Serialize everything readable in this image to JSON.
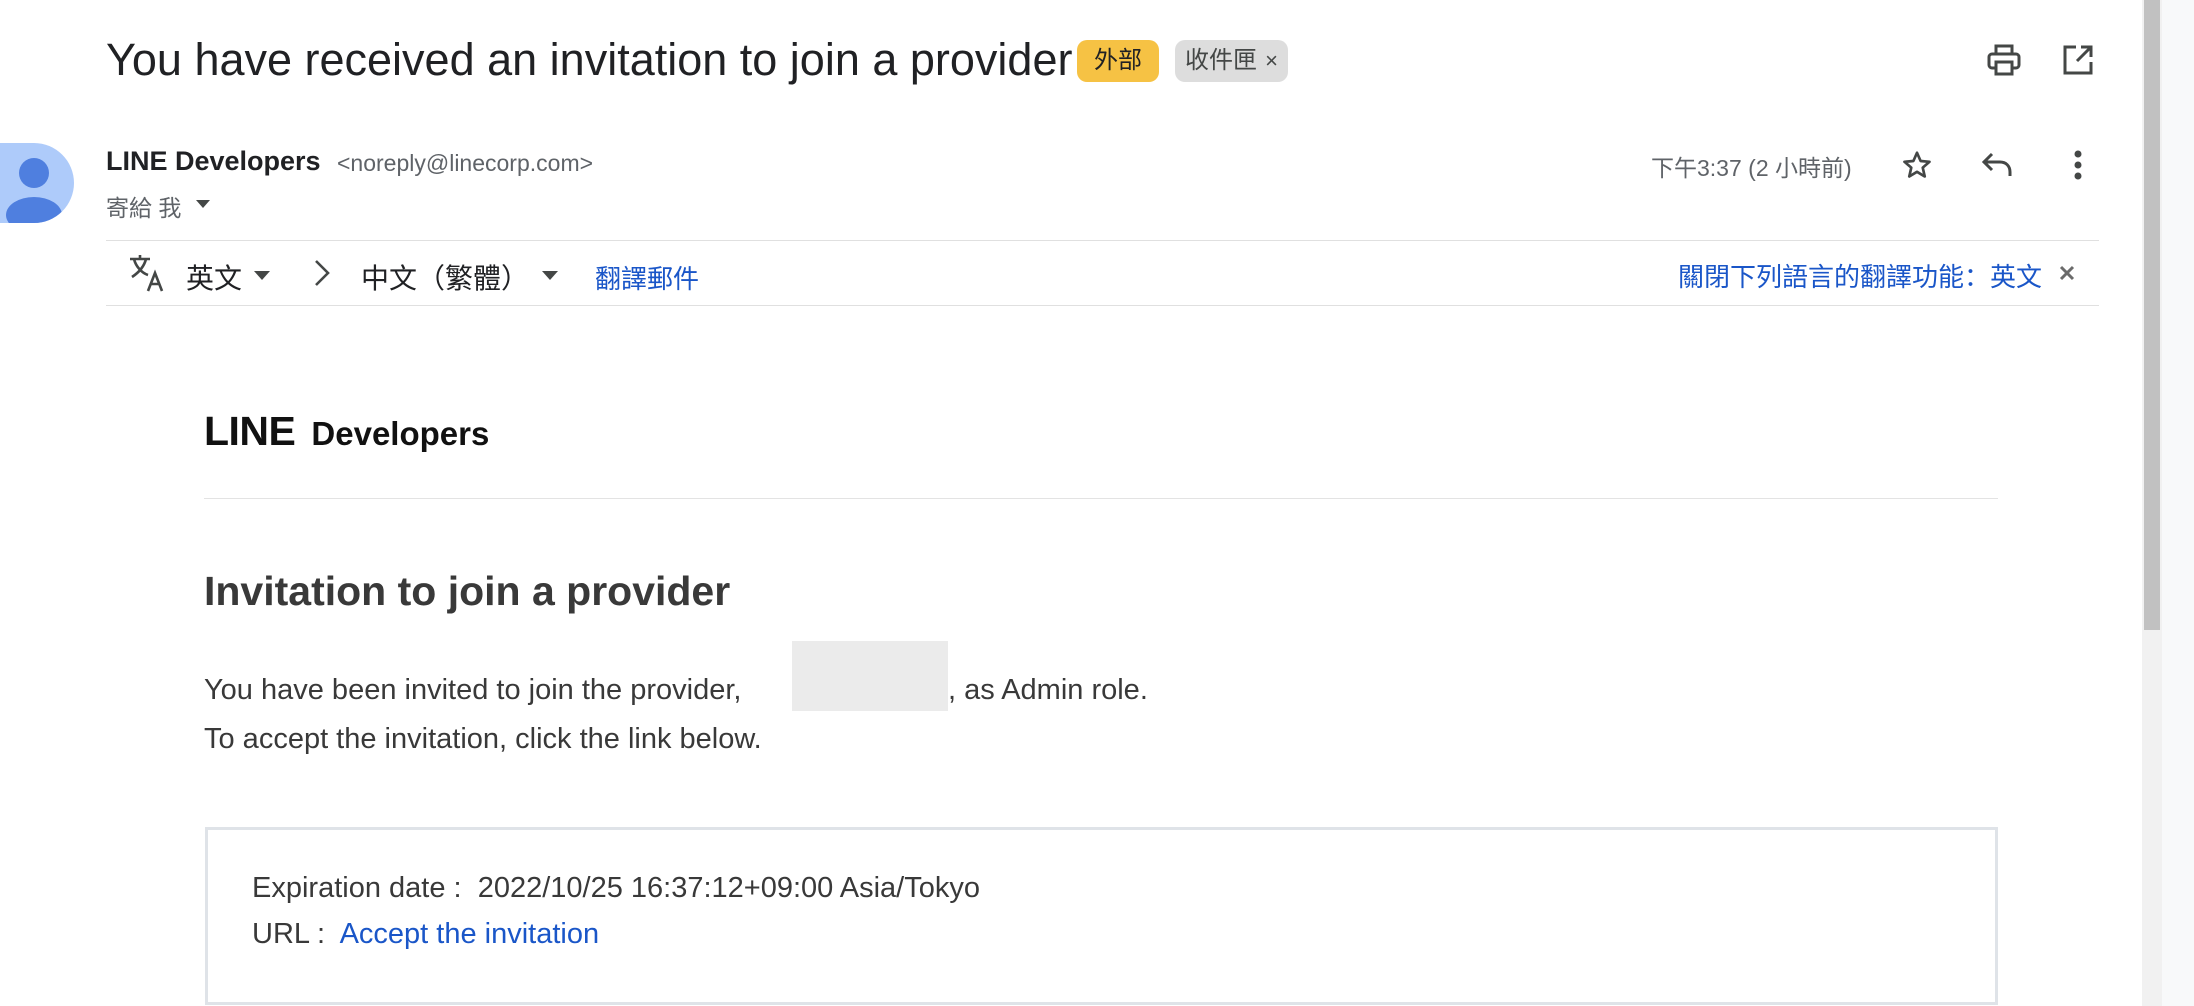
{
  "header": {
    "subject": "You have received an invitation to join a provider",
    "labels": {
      "external": "外部",
      "inbox": "收件匣",
      "inbox_remove": "×"
    },
    "icons": [
      "print-icon",
      "open-in-new-window-icon"
    ]
  },
  "message": {
    "sender_name": "LINE Developers",
    "sender_email": "<noreply@linecorp.com>",
    "recipient": "寄給 我",
    "time": "下午3:37 (2 小時前)",
    "actions": [
      "star-icon",
      "reply-icon",
      "more-vert-icon"
    ]
  },
  "translate_bar": {
    "source_language": "英文",
    "target_language": "中文（繁體）",
    "translate_link": "翻譯郵件",
    "turn_off_link": "關閉下列語言的翻譯功能：英文"
  },
  "email_body": {
    "brand_line": "LINE",
    "brand_developers": "Developers",
    "heading": "Invitation to join a provider",
    "text_before_name": "You have been invited to join the provider,",
    "text_after_name": ", as Admin role.",
    "text_accept": "To accept the invitation, click the link below.",
    "expiration_label": "Expiration date :",
    "expiration_value": "2022/10/25 16:37:12+09:00 Asia/Tokyo",
    "url_label": "URL :",
    "accept_link": "Accept the invitation"
  },
  "colors": {
    "external_label": "#f6c244",
    "inbox_label": "#dddddd",
    "link": "#1a56c8",
    "avatar": "#aecbfa",
    "avatar_figure": "#4f7fdf"
  }
}
